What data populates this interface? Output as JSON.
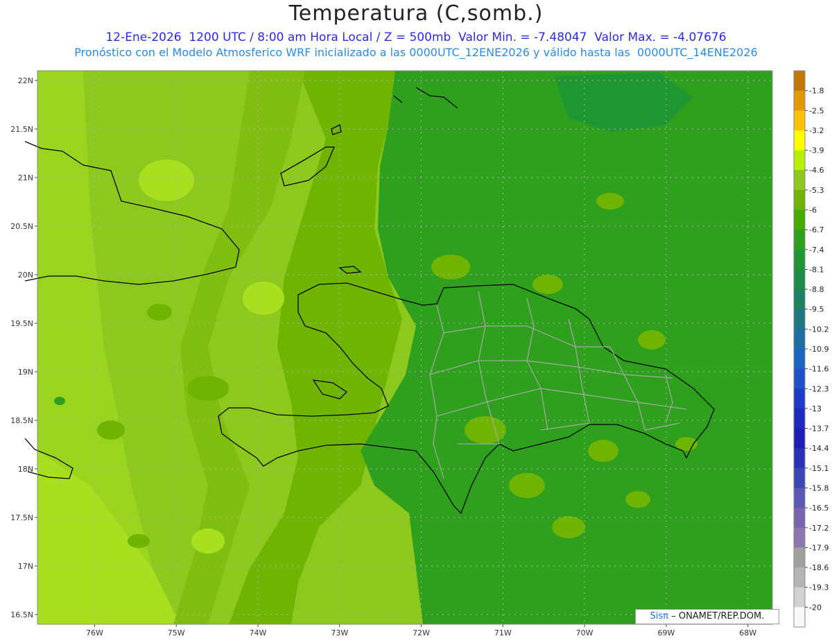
{
  "title": "Temperatura (C,somb.)",
  "subtitle_line1": "12-Ene-2026  1200 UTC / 8:00 am Hora Local / Z = 500mb  Valor Min. = -7.48047  Valor Max. = -4.07676",
  "subtitle_line2": "Pronóstico con el Modelo Atmosferico WRF inicializado a las 0000UTC_12ENE2026 y válido hasta las  0000UTC_14ENE2026",
  "credit": {
    "logo": "Sisπ",
    "text": "– ONAMET/REP.DOM."
  },
  "axes": {
    "lat_labels": [
      "22N",
      "21.5N",
      "21N",
      "20.5N",
      "20N",
      "19.5N",
      "19N",
      "18.5N",
      "18N",
      "17.5N",
      "17N",
      "16.5N"
    ],
    "lon_labels": [
      "76W",
      "75W",
      "74W",
      "73W",
      "72W",
      "71W",
      "70W",
      "69W",
      "68W"
    ],
    "lat_range": [
      16.4,
      22.1
    ],
    "lon_range": [
      -76.7,
      -67.7
    ]
  },
  "colorbar": {
    "labels": [
      "-1.8",
      "-2.5",
      "-3.2",
      "-3.9",
      "-4.6",
      "-5.3",
      "-6",
      "-6.7",
      "-7.4",
      "-8.1",
      "-8.8",
      "-9.5",
      "-10.2",
      "-10.9",
      "-11.6",
      "-12.3",
      "-13",
      "-13.7",
      "-14.4",
      "-15.1",
      "-15.8",
      "-16.5",
      "-17.2",
      "-17.9",
      "-18.6",
      "-19.3",
      "-20"
    ],
    "colors": [
      "#c07800",
      "#e09a00",
      "#ffc000",
      "#ffff00",
      "#b4f000",
      "#8cc81e",
      "#6eb400",
      "#46aa00",
      "#2ea01e",
      "#1e9632",
      "#1e8c46",
      "#1e8264",
      "#1e7882",
      "#1e6ea0",
      "#1e64be",
      "#1e50c8",
      "#1e3cc8",
      "#1e28be",
      "#1e1eb4",
      "#2832b4",
      "#3c46b4",
      "#5a5ab4",
      "#7864aa",
      "#8c78aa",
      "#a0a0a0",
      "#b4b4b4",
      "#d2d2d2",
      "#f8f8f8"
    ]
  },
  "map_colors": {
    "band_far_west": "#a8e020",
    "band_west": "#8cc81e",
    "band_central": "#6eb400",
    "band_east": "#2ea01e",
    "coast": "#000000",
    "provinces": "#a8a8a8",
    "grid": "#b4b4b4"
  }
}
